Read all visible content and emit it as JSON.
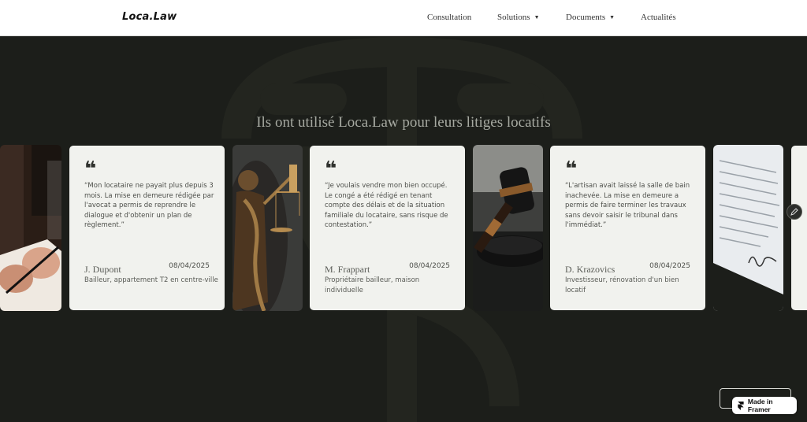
{
  "header": {
    "logo": "Loca.Law",
    "nav": [
      {
        "label": "Consultation",
        "has_caret": false
      },
      {
        "label": "Solutions",
        "has_caret": true
      },
      {
        "label": "Documents",
        "has_caret": true
      },
      {
        "label": "Actualités",
        "has_caret": false
      }
    ]
  },
  "section": {
    "title": "Ils ont utilisé Loca.Law pour leurs litiges locatifs"
  },
  "testimonials": [
    {
      "quote": "“Mon locataire ne payait plus depuis 3 mois. La mise en demeure rédigée par l'avocat a permis de reprendre le dialogue et d'obtenir un plan de règlement.”",
      "author": "J. Dupont",
      "date": "08/04/2025",
      "role": "Bailleur, appartement T2 en centre-ville"
    },
    {
      "quote": "“Je voulais vendre mon bien occupé. Le congé a été rédigé en tenant compte des délais et de la situation familiale du locataire, sans risque de contestation.”",
      "author": "M. Frappart",
      "date": "08/04/2025",
      "role": "Propriétaire bailleur, maison individuelle"
    },
    {
      "quote": "“L'artisan avait laissé la salle de bain inachevée. La mise en demeure a permis de faire terminer les travaux sans devoir saisir le tribunal dans l'immédiat.”",
      "author": "D. Krazovics",
      "date": "08/04/2025",
      "role": "Investisseur, rénovation d'un bien locatif"
    }
  ],
  "images": [
    {
      "subject": "hand-signing-document"
    },
    {
      "subject": "lady-justice-statue"
    },
    {
      "subject": "judge-gavel"
    },
    {
      "subject": "signed-contract-paper"
    }
  ],
  "badge": {
    "label": "Made in Framer"
  },
  "colors": {
    "background": "#1c1e1a",
    "card": "#f1f2ee",
    "title": "#a6a9a1",
    "header": "#ffffff"
  }
}
